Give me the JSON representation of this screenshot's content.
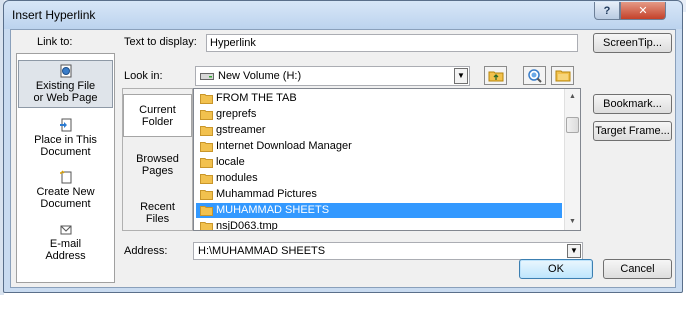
{
  "window": {
    "title": "Insert Hyperlink",
    "help_label": "?",
    "close_label": "✕"
  },
  "link_to": {
    "label": "Link to:",
    "items": [
      {
        "label_lines": [
          "Existing File",
          "or Web Page"
        ],
        "icon": "globe-file-icon",
        "selected": true
      },
      {
        "label_lines": [
          "Place in This",
          "Document"
        ],
        "icon": "document-place-icon",
        "selected": false
      },
      {
        "label_lines": [
          "Create New",
          "Document"
        ],
        "icon": "new-document-icon",
        "selected": false
      },
      {
        "label_lines": [
          "E-mail",
          "Address"
        ],
        "icon": "email-icon",
        "selected": false
      }
    ]
  },
  "text_to_display": {
    "label": "Text to display:",
    "value": "Hyperlink"
  },
  "screentip_button": "ScreenTip...",
  "look_in": {
    "label": "Look in:",
    "value": "New Volume (H:)",
    "icon": "drive-icon"
  },
  "toolbar_icons": [
    "up-folder-icon",
    "browse-web-icon",
    "browse-file-icon"
  ],
  "nav": {
    "items": [
      {
        "label_lines": [
          "Current",
          "Folder"
        ],
        "selected": true
      },
      {
        "label_lines": [
          "Browsed",
          "Pages"
        ],
        "selected": false
      },
      {
        "label_lines": [
          "Recent",
          "Files"
        ],
        "selected": false
      }
    ]
  },
  "files": [
    {
      "name": "FROM THE TAB",
      "selected": false
    },
    {
      "name": "greprefs",
      "selected": false
    },
    {
      "name": "gstreamer",
      "selected": false
    },
    {
      "name": "Internet Download Manager",
      "selected": false
    },
    {
      "name": "locale",
      "selected": false
    },
    {
      "name": "modules",
      "selected": false
    },
    {
      "name": "Muhammad Pictures",
      "selected": false
    },
    {
      "name": "MUHAMMAD SHEETS",
      "selected": true
    },
    {
      "name": "nsjD063.tmp",
      "selected": false
    }
  ],
  "side_buttons": {
    "bookmark": "Bookmark...",
    "target_frame": "Target Frame..."
  },
  "address": {
    "label": "Address:",
    "value": "H:\\MUHAMMAD SHEETS"
  },
  "footer": {
    "ok": "OK",
    "cancel": "Cancel"
  },
  "colors": {
    "selection": "#3399ff",
    "frame": "#c9dbf0",
    "folder": "#f2c14e"
  }
}
